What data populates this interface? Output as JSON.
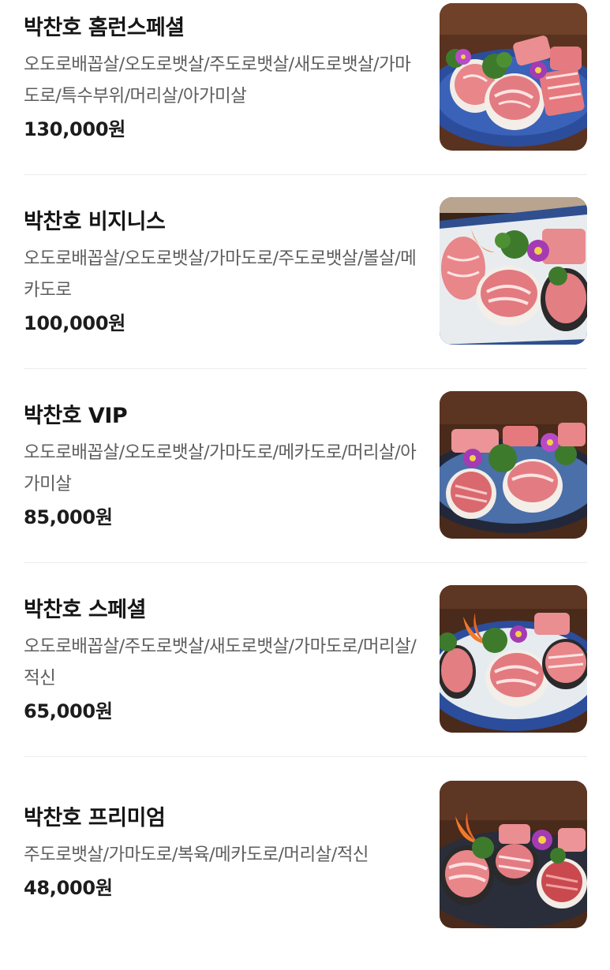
{
  "menu_items": [
    {
      "name": "박찬호 홈런스페셜",
      "description": "오도로배꼽살/오도로뱃살/주도로뱃살/새도로뱃살/가마도로/특수부위/머리살/아가미살",
      "price": "130,000원",
      "image": "tuna-platter-photo"
    },
    {
      "name": "박찬호 비지니스",
      "description": "오도로배꼽살/오도로뱃살/가마도로/주도로뱃살/볼살/메카도로",
      "price": "100,000원",
      "image": "tuna-platter-photo"
    },
    {
      "name": "박찬호 VIP",
      "description": "오도로배꼽살/오도로뱃살/가마도로/메카도로/머리살/아가미살",
      "price": "85,000원",
      "image": "tuna-platter-photo"
    },
    {
      "name": "박찬호 스페셜",
      "description": "오도로배꼽살/주도로뱃살/새도로뱃살/가마도로/머리살/적신",
      "price": "65,000원",
      "image": "tuna-platter-photo"
    },
    {
      "name": "박찬호 프리미엄",
      "description": "주도로뱃살/가마도로/복육/메카도로/머리살/적신",
      "price": "48,000원",
      "image": "tuna-platter-photo"
    }
  ],
  "colors": {
    "name_text": "#151515",
    "desc_text": "#5e5e5e",
    "price_text": "#1c1c1c",
    "divider": "#ececec",
    "tuna_pink": "#e8868a",
    "plate_blue": "#2b4d9c",
    "wood_brown": "#4a2a1a",
    "garnish_green": "#3e7a2c",
    "orchid_purple": "#a53bb3"
  }
}
